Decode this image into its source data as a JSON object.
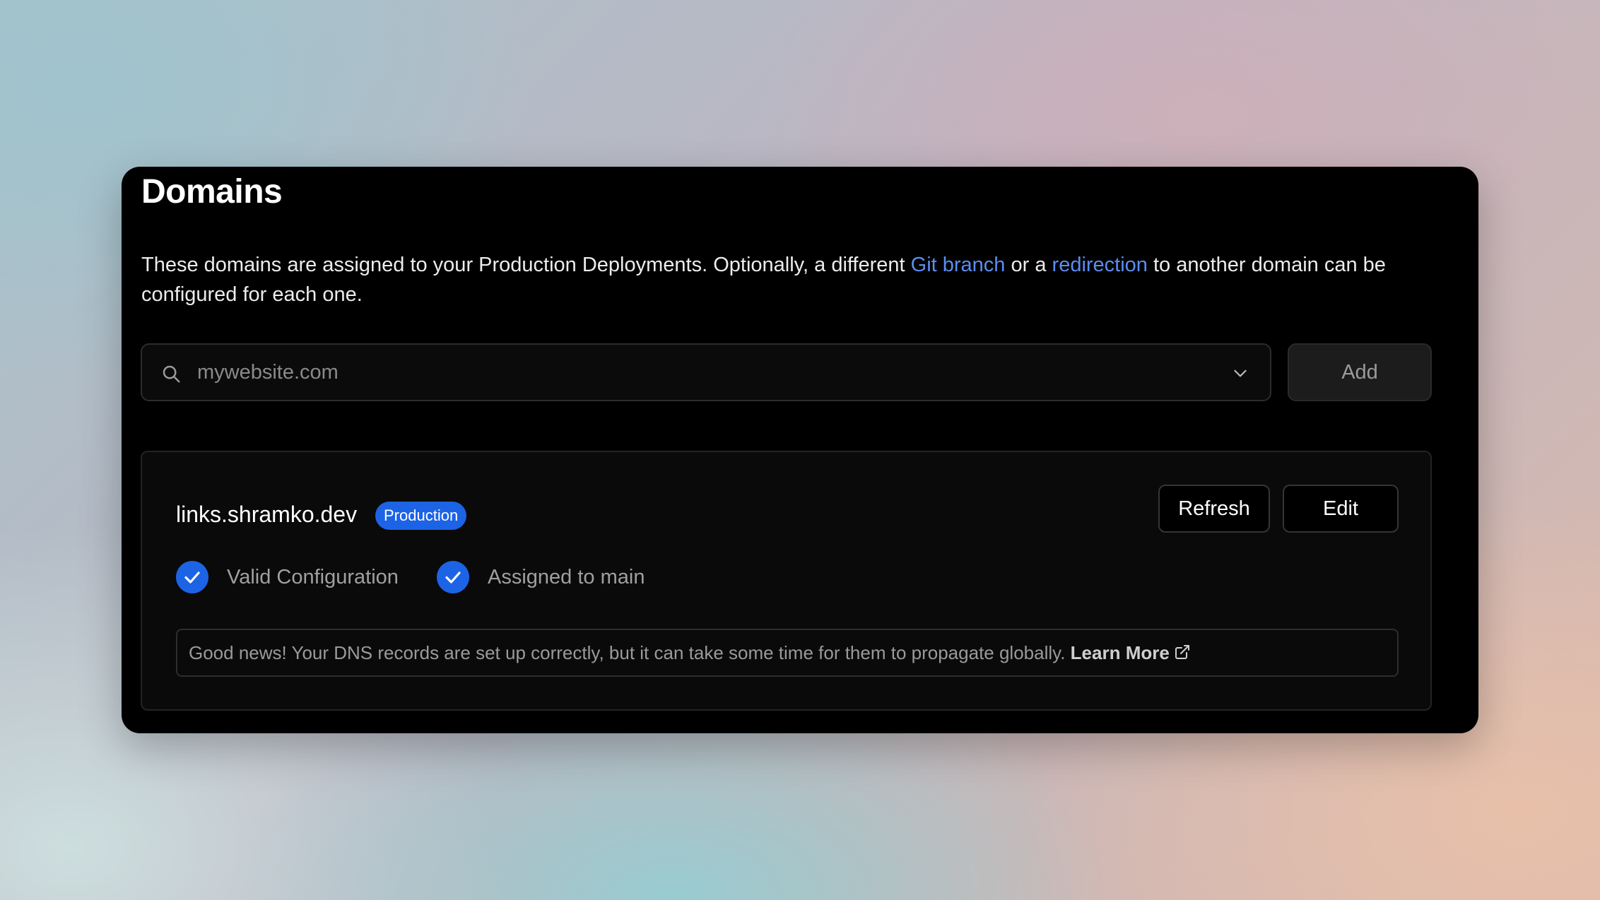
{
  "header": {
    "title": "Domains"
  },
  "description": {
    "part1": "These domains are assigned to your Production Deployments. Optionally, a different ",
    "git_branch_link": "Git branch",
    "part2": " or a ",
    "redirection_link": "redirection",
    "part3": " to another domain can be configured for each one."
  },
  "search": {
    "placeholder": "mywebsite.com",
    "value": "",
    "icon": "search-icon",
    "dropdown_icon": "chevron-down-icon"
  },
  "add_button": {
    "label": "Add"
  },
  "domain_card": {
    "domain": "links.shramko.dev",
    "badge": "Production",
    "refresh_label": "Refresh",
    "edit_label": "Edit",
    "checks": [
      {
        "label": "Valid Configuration",
        "icon": "check-circle-icon"
      },
      {
        "label": "Assigned to main",
        "icon": "check-circle-icon"
      }
    ],
    "notice": {
      "text": "Good news! Your DNS records are set up correctly, but it can take some time for them to propagate globally.",
      "link_label": "Learn More",
      "link_icon": "external-link-icon"
    }
  },
  "colors": {
    "accent": "#1d63e6",
    "link": "#5b8def",
    "panel_background": "#000000"
  }
}
